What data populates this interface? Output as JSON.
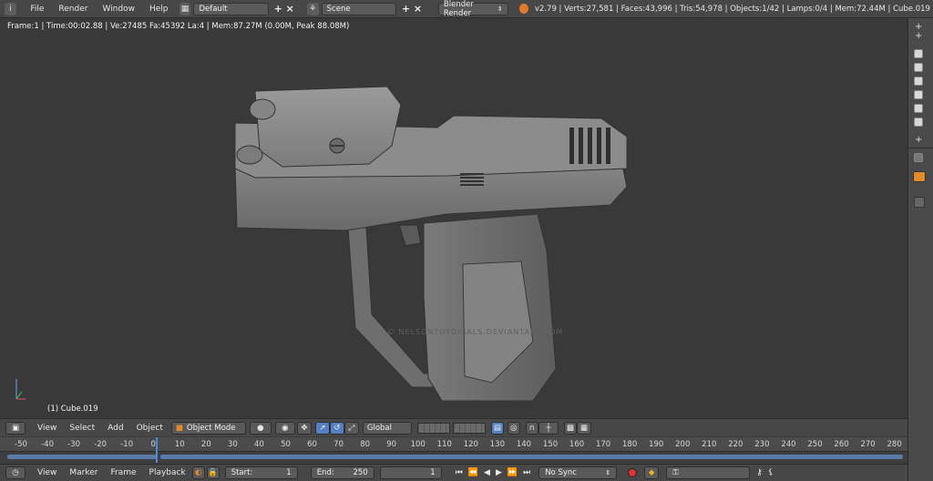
{
  "topbar": {
    "menus": [
      "File",
      "Render",
      "Window",
      "Help"
    ],
    "screen_layout": "Default",
    "scene": "Scene",
    "render_engine": "Blender Render",
    "stats": "v2.79 | Verts:27,581 | Faces:43,996 | Tris:54,978 | Objects:1/42 | Lamps:0/4 | Mem:72.44M | Cube.019"
  },
  "viewport": {
    "frame_info": "Frame:1 | Time:00:02.88 | Ve:27485 Fa:45392 La:4 | Mem:87.27M (0.00M, Peak 88.08M)",
    "object_label": "(1) Cube.019",
    "watermark": "© NELSONTUTORIALS.DEVIANTART.COM"
  },
  "viewheader": {
    "view": "View",
    "select": "Select",
    "add": "Add",
    "object": "Object",
    "mode": "Object Mode",
    "orientation": "Global"
  },
  "timeline": {
    "ticks": [
      -50,
      -40,
      -30,
      -20,
      -10,
      0,
      10,
      20,
      30,
      40,
      50,
      60,
      70,
      80,
      90,
      100,
      110,
      120,
      130,
      140,
      150,
      160,
      170,
      180,
      190,
      200,
      210,
      220,
      230,
      240,
      250,
      260,
      270,
      280
    ]
  },
  "bottombar": {
    "view": "View",
    "marker": "Marker",
    "frame": "Frame",
    "playback": "Playback",
    "start_label": "Start:",
    "start_value": "1",
    "end_label": "End:",
    "end_value": "250",
    "current_frame": "1",
    "sync": "No Sync"
  },
  "colors": {
    "accent": "#4a8ad6",
    "record": "#dd3333"
  }
}
